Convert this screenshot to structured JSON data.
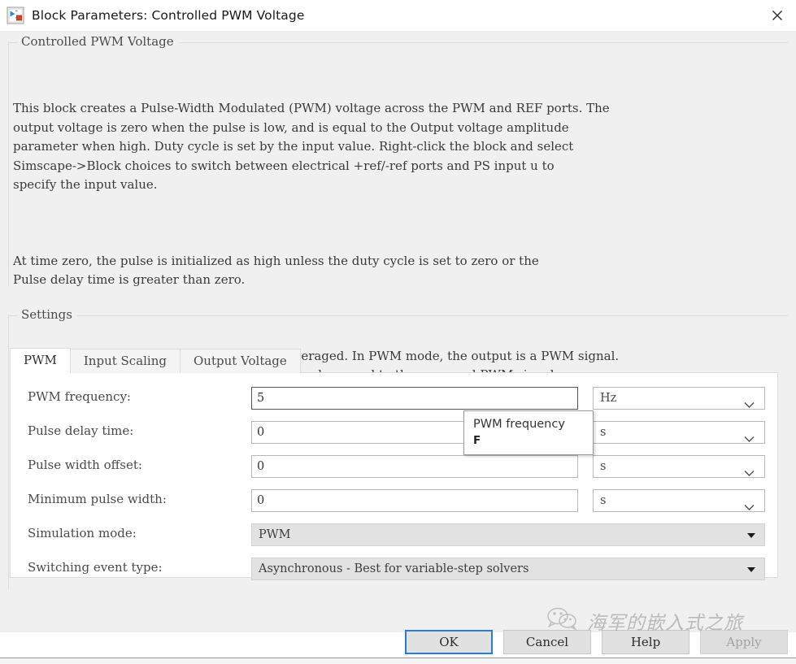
{
  "window": {
    "title": "Block Parameters: Controlled PWM Voltage",
    "icon": "simulink-block-icon",
    "close_icon": "close-icon"
  },
  "description": {
    "legend": "Controlled PWM Voltage",
    "paragraphs": [
      "This block creates a Pulse-Width Modulated (PWM) voltage across the PWM and REF ports. The\noutput voltage is zero when the pulse is low, and is equal to the Output voltage amplitude\nparameter when high. Duty cycle is set by the input value. Right-click the block and select\nSimscape->Block choices to switch between electrical +ref/-ref ports and PS input u to\nspecify the input value.",
      "At time zero, the pulse is initialized as high unless the duty cycle is set to zero or the\nPulse delay time is greater than zero.",
      "The Simulation mode can be set to PWM or Averaged. In PWM mode, the output is a PWM signal.\nIn Averaged mode, the output is constant with value equal to the averaged PWM signal."
    ]
  },
  "settings": {
    "legend": "Settings",
    "tabs": [
      {
        "label": "PWM",
        "active": true
      },
      {
        "label": "Input Scaling",
        "active": false
      },
      {
        "label": "Output Voltage",
        "active": false
      }
    ],
    "fields": [
      {
        "label": "PWM frequency:",
        "value": "5",
        "unit": "Hz",
        "type": "text",
        "focused": true
      },
      {
        "label": "Pulse delay time:",
        "value": "0",
        "unit": "s",
        "type": "text",
        "focused": false
      },
      {
        "label": "Pulse width offset:",
        "value": "0",
        "unit": "s",
        "type": "text",
        "focused": false
      },
      {
        "label": "Minimum pulse width:",
        "value": "0",
        "unit": "s",
        "type": "text",
        "focused": false
      },
      {
        "label": "Simulation mode:",
        "value": "PWM",
        "type": "combo"
      },
      {
        "label": "Switching event type:",
        "value": "Asynchronous - Best for variable-step solvers",
        "type": "combo"
      }
    ]
  },
  "tooltip": {
    "title": "PWM frequency",
    "symbol": "F"
  },
  "buttons": [
    {
      "label": "OK",
      "state": "default"
    },
    {
      "label": "Cancel",
      "state": "normal"
    },
    {
      "label": "Help",
      "state": "normal"
    },
    {
      "label": "Apply",
      "state": "disabled"
    }
  ],
  "watermark": {
    "icon": "wechat-icon",
    "text": "海军的嵌入式之旅"
  },
  "colors": {
    "accent": "#2b7cd3",
    "window_bg": "#f0f0f0",
    "panel_bg": "#ffffff",
    "combo_bg": "#e2e2e2",
    "border": "#dcdcdc"
  }
}
